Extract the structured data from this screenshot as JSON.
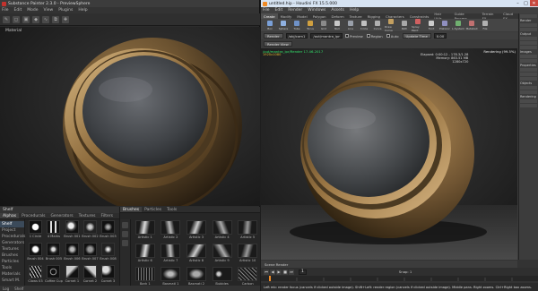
{
  "painter": {
    "title": "Substance Painter 2.3.0 - PreviewSphere",
    "menus": [
      "File",
      "Edit",
      "Mode",
      "View",
      "Plugins",
      "Help"
    ],
    "viewport_label": "Material",
    "shelf": {
      "title": "Shelf",
      "tabs": [
        "Alphas",
        "Procedurals",
        "Generators",
        "Textures",
        "Filters"
      ],
      "categories": [
        "Shelf",
        "Project",
        "Procedurals",
        "Generators",
        "Textures",
        "Brushes",
        "Particles",
        "Tools",
        "Materials",
        "Smart M."
      ],
      "alphas": [
        "1 Circle",
        "4 Marks",
        "Brush 001",
        "Brush 002",
        "Brush 003",
        "Brush 004",
        "Brush 005",
        "Brush 006",
        "Brush 007",
        "Brush 008",
        "Claws 03",
        "Coffee Cup",
        "Cornet 1",
        "Cornet 2",
        "Cornet 3"
      ],
      "brush_tabs": [
        "Brushes",
        "Particles",
        "Tools"
      ],
      "brushes": [
        "Artistic 1",
        "Artistic 2",
        "Artistic 3",
        "Artistic 4",
        "Artistic 5",
        "Artistic 6",
        "Artistic 7",
        "Artistic 8",
        "Artistic 9",
        "Artistic 10",
        "Bark 1",
        "Basmati 1",
        "Basmati 2",
        "Bubbles",
        "Carbon"
      ]
    },
    "status_left": "Log",
    "status_right": "Shelf"
  },
  "houdini": {
    "title": "untitled.hip - Houdini FX 15.5.000",
    "menus": [
      "File",
      "Edit",
      "Render",
      "Windows",
      "Assets",
      "Help"
    ],
    "shelf_tabs": [
      "Create",
      "Modify",
      "Model",
      "Polygon",
      "Deform",
      "Texture",
      "Rigging",
      "Characters",
      "Constraints",
      "Hair Utils",
      "Guide Process",
      "Terrain FX",
      "Cloud FX",
      "Volume"
    ],
    "shelf_tools": [
      {
        "label": "Box",
        "color": "#7aa0d8"
      },
      {
        "label": "Sphere",
        "color": "#8fb0e0"
      },
      {
        "label": "Tube",
        "color": "#6f92c8"
      },
      {
        "label": "Torus",
        "color": "#d0a040"
      },
      {
        "label": "Grid",
        "color": "#8a8a8a"
      },
      {
        "label": "Null",
        "color": "#c8c8c8"
      },
      {
        "label": "Line",
        "color": "#9aa0aa"
      },
      {
        "label": "Circle",
        "color": "#c0c0c0"
      },
      {
        "label": "Curve",
        "color": "#b0b0b0"
      },
      {
        "label": "Draw Curve",
        "color": "#c4a060"
      },
      {
        "label": "Path",
        "color": "#a8a8a8"
      },
      {
        "label": "Spray Paint",
        "color": "#d06060"
      },
      {
        "label": "Font",
        "color": "#cccccc"
      },
      {
        "label": "Platonic",
        "color": "#9090c0"
      },
      {
        "label": "L-System",
        "color": "#70b070"
      },
      {
        "label": "Metaball",
        "color": "#c07070"
      },
      {
        "label": "File",
        "color": "#b0b0b0"
      }
    ],
    "controls": {
      "render": "Render",
      "camera": "/obj/cam1",
      "renderer": "/out/mantra_ipr",
      "preview": "Preview",
      "region": "Region",
      "auto": "Auto",
      "update": "Update Time",
      "update_value": "0.00"
    },
    "render_bar": "Render View",
    "viewport": {
      "path": "/out/mantra_ipr/Render 17.46.2017",
      "sub": "1920x1080",
      "status": "Rendering (99.5%)",
      "elapsed": "Elapsed: 0:00:12 - 178.3/1.28",
      "memory": "Memory: 863.51 MB",
      "res": "1280x720"
    },
    "right_panel": [
      "Render",
      "Output",
      "Images",
      "Properties",
      "Objects",
      "Rendering"
    ],
    "thumbs_label": "Scene Render",
    "timeline": {
      "frame": "1",
      "snap": "Snap: 1"
    },
    "status": "Left mb: render focus (cancels if clicked outside image). Shift+Left: render region (cancels if clicked outside image). Middle pans. Right zooms. Ctrl+Right box zooms."
  }
}
